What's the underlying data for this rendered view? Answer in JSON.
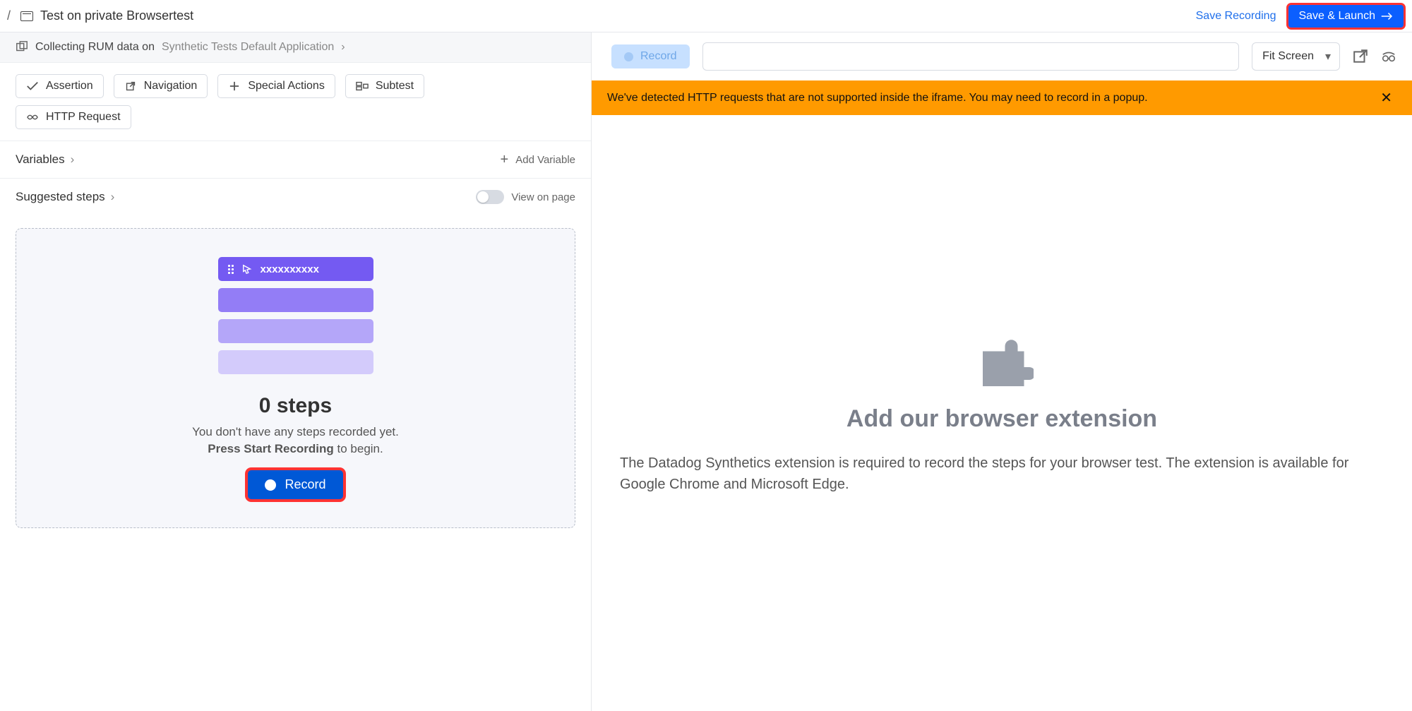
{
  "topbar": {
    "breadcrumb_sep": "/",
    "title": "Test on private Browsertest",
    "save_recording": "Save Recording",
    "save_launch": "Save & Launch"
  },
  "rum": {
    "prefix": "Collecting RUM data on ",
    "app_name": "Synthetic Tests Default Application"
  },
  "actions": {
    "assertion": "Assertion",
    "navigation": "Navigation",
    "special": "Special Actions",
    "subtest": "Subtest",
    "http": "HTTP Request"
  },
  "sections": {
    "variables": "Variables",
    "add_variable": "Add Variable",
    "suggested": "Suggested steps",
    "view_on_page": "View on page"
  },
  "steps_card": {
    "stack_label": "xxxxxxxxxx",
    "heading": "0 steps",
    "line1": "You don't have any steps recorded yet.",
    "line2a": "Press Start Recording",
    "line2b": " to begin.",
    "record": "Record"
  },
  "right": {
    "record": "Record",
    "url_value": "",
    "fit": "Fit Screen"
  },
  "warn": {
    "text": "We've detected HTTP requests that are not supported inside the iframe. You may need to record in a popup."
  },
  "extension": {
    "heading": "Add our browser extension",
    "body": "The Datadog Synthetics extension is required to record the steps for your browser test. The extension is available for Google Chrome and Microsoft Edge."
  }
}
